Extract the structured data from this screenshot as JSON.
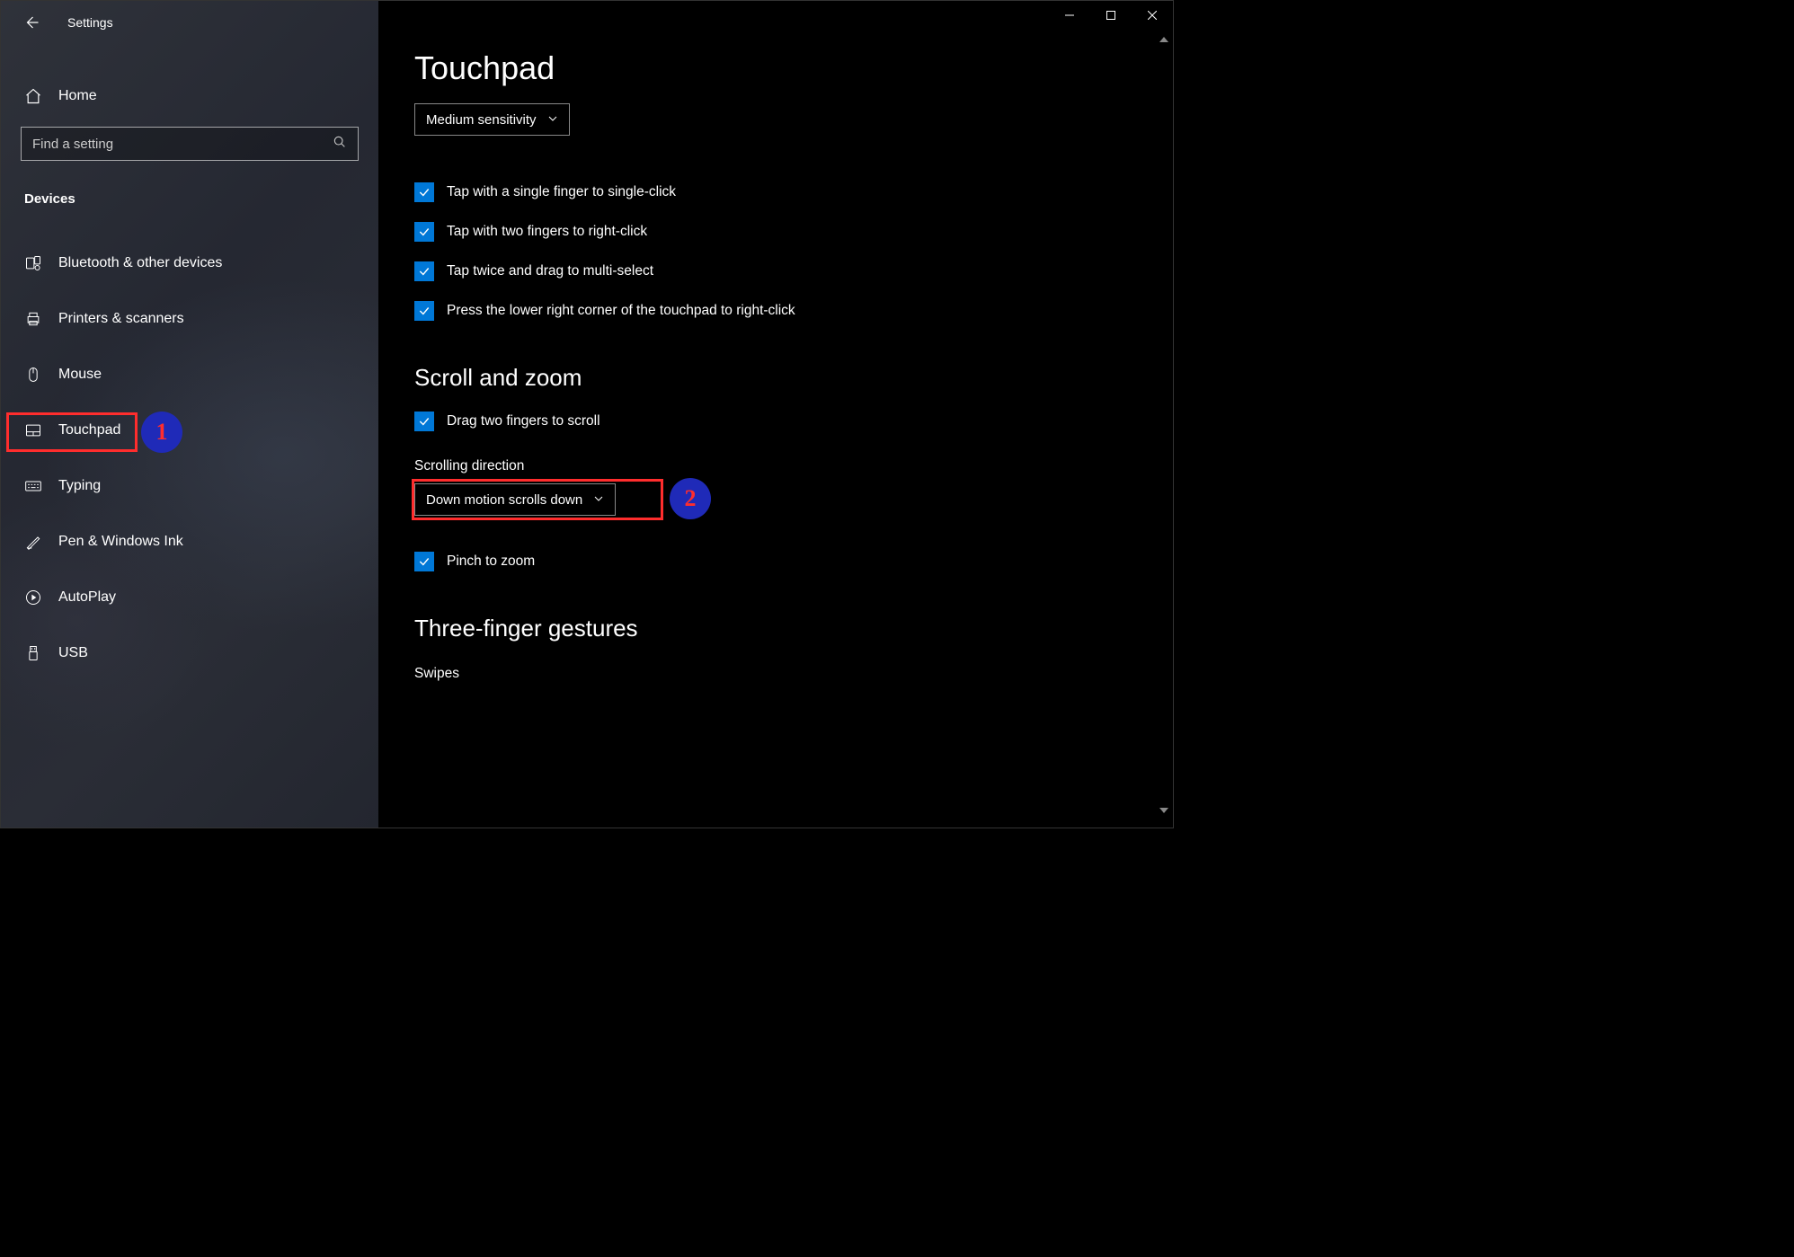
{
  "header": {
    "app_title": "Settings",
    "home_label": "Home",
    "search_placeholder": "Find a setting",
    "category_label": "Devices"
  },
  "sidebar": {
    "items": [
      {
        "label": "Bluetooth & other devices",
        "icon": "bluetooth-devices-icon"
      },
      {
        "label": "Printers & scanners",
        "icon": "printer-icon"
      },
      {
        "label": "Mouse",
        "icon": "mouse-icon"
      },
      {
        "label": "Touchpad",
        "icon": "touchpad-icon"
      },
      {
        "label": "Typing",
        "icon": "keyboard-icon"
      },
      {
        "label": "Pen & Windows Ink",
        "icon": "pen-icon"
      },
      {
        "label": "AutoPlay",
        "icon": "autoplay-icon"
      },
      {
        "label": "USB",
        "icon": "usb-icon"
      }
    ]
  },
  "main": {
    "page_title": "Touchpad",
    "sensitivity_dropdown": "Medium sensitivity",
    "taps": [
      "Tap with a single finger to single-click",
      "Tap with two fingers to right-click",
      "Tap twice and drag to multi-select",
      "Press the lower right corner of the touchpad to right-click"
    ],
    "scroll_zoom_heading": "Scroll and zoom",
    "scroll_checks": [
      "Drag two fingers to scroll"
    ],
    "scroll_direction_label": "Scrolling direction",
    "scroll_direction_value": "Down motion scrolls down",
    "pinch_check": "Pinch to zoom",
    "three_finger_heading": "Three-finger gestures",
    "swipes_label": "Swipes"
  },
  "annotations": {
    "one": "1",
    "two": "2"
  }
}
